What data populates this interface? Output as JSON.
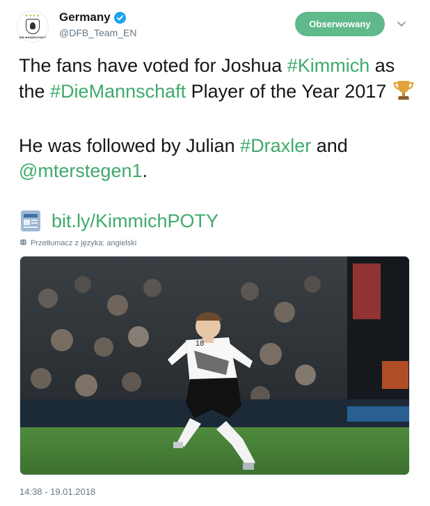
{
  "account": {
    "display_name": "Germany",
    "handle": "@DFB_Team_EN",
    "avatar_label": "DIE MANNSCHAFT",
    "verified": true
  },
  "follow_button": {
    "label": "Obserwowany",
    "color": "#5fb98b"
  },
  "tweet": {
    "line1_prefix": "The fans have voted for Joshua ",
    "hashtag_kimmich": "#Kimmich",
    "line1_mid": " as the ",
    "hashtag_diemannschaft": "#DieMannschaft",
    "line1_suffix": " Player of the Year 2017 ",
    "emoji": "trophy-icon",
    "line2_prefix": "He was followed by Julian ",
    "hashtag_draxler": "#Draxler",
    "line2_mid": " and ",
    "mention": "@mterstegen1",
    "line2_suffix": ".",
    "link_icon": "newspaper-icon",
    "link_text": "bit.ly/KimmichPOTY"
  },
  "translate_note": "Przetłumacz z języka: angielski",
  "media": {
    "alt": "Joshua Kimmich running on the pitch",
    "shirt_number": "18"
  },
  "timestamp": "14:38 - 19.01.2018",
  "colors": {
    "link": "#3faa6b",
    "text": "#14171a",
    "muted": "#657786",
    "verified": "#1da1f2"
  }
}
